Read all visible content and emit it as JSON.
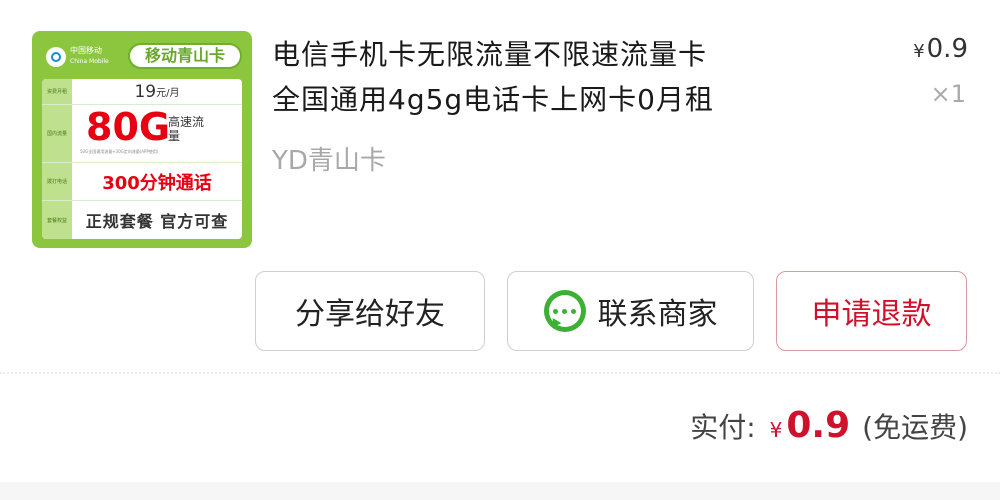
{
  "product": {
    "thumbnail": {
      "carrier_cn": "中国移动",
      "carrier_en": "China Mobile",
      "brand_pill": "移动青山卡",
      "labels": [
        "资费月租",
        "国内流量",
        "拨打电话",
        "套餐权益"
      ],
      "price_num": "19",
      "price_unit": "元/月",
      "data_amount": "80G",
      "data_speed": "高速流量",
      "data_fine_print": "50G全国通用流量+30G定向流量(APP使用)",
      "minutes": "300分钟通话",
      "formal": "正规套餐 官方可查"
    },
    "title_line1": "电信手机卡无限流量不限速流量卡",
    "title_line2": "全国通用4g5g电话卡上网卡0月租",
    "seller": "YD青山卡",
    "currency_symbol": "¥",
    "unit_price": "0.9",
    "quantity": "×1"
  },
  "actions": {
    "share_label": "分享给好友",
    "contact_label": "联系商家",
    "refund_label": "申请退款"
  },
  "summary": {
    "paid_label": "实付:",
    "currency_symbol": "¥",
    "paid_amount": "0.9",
    "shipping_note": "(免运费)"
  },
  "colors": {
    "accent_red": "#d0112b",
    "thumb_green": "#8cc63f",
    "wechat_green": "#3cb034"
  },
  "icons": {
    "chat": "chat-bubble-icon",
    "logo": "china-mobile-logo-icon"
  }
}
